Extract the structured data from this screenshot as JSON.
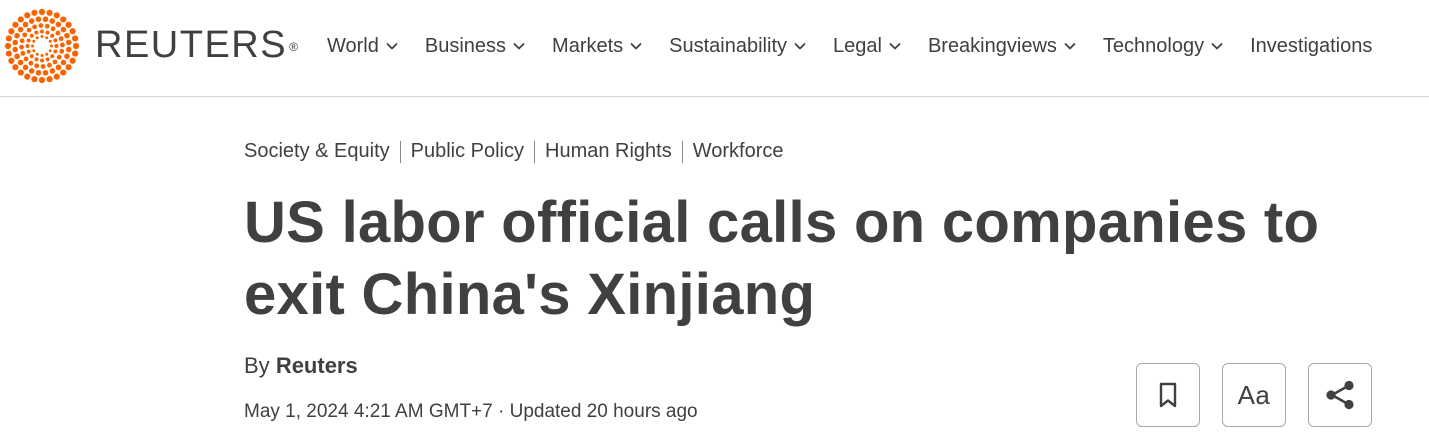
{
  "brand": {
    "wordmark": "REUTERS",
    "registered_mark": "®",
    "accent_color": "#fa6400"
  },
  "nav": {
    "items": [
      {
        "label": "World"
      },
      {
        "label": "Business"
      },
      {
        "label": "Markets"
      },
      {
        "label": "Sustainability"
      },
      {
        "label": "Legal"
      },
      {
        "label": "Breakingviews"
      },
      {
        "label": "Technology"
      },
      {
        "label": "Investigations"
      }
    ],
    "chevron_icon": "chevron-down-icon"
  },
  "article": {
    "topics": [
      {
        "label": "Society & Equity"
      },
      {
        "label": "Public Policy"
      },
      {
        "label": "Human Rights"
      },
      {
        "label": "Workforce"
      }
    ],
    "headline": "US labor official calls on companies to exit China's Xinjiang",
    "byline_prefix": "By",
    "author": "Reuters",
    "dateline": "May 1, 2024 4:21 AM GMT+7 · Updated 20 hours ago"
  },
  "tools": {
    "bookmark_icon": "bookmark-icon",
    "text_size_label": "Aa",
    "share_icon": "share-icon"
  }
}
